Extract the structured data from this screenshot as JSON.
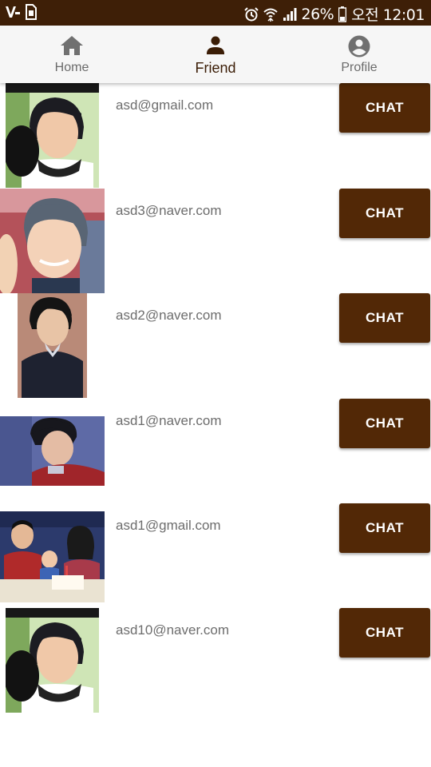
{
  "status_bar": {
    "battery": "26%",
    "time": "오전 12:01",
    "icons": [
      "app-v-icon",
      "sim-icon",
      "alarm-icon",
      "wifi-icon",
      "signal-icon",
      "battery-icon"
    ]
  },
  "nav": {
    "items": [
      {
        "label": "Home",
        "icon": "home-icon",
        "active": false
      },
      {
        "label": "Friend",
        "icon": "person-icon",
        "active": true
      },
      {
        "label": "Profile",
        "icon": "account-circle-icon",
        "active": false
      }
    ]
  },
  "friends": [
    {
      "email": "asd@gmail.com",
      "button": "CHAT"
    },
    {
      "email": "asd3@naver.com",
      "button": "CHAT"
    },
    {
      "email": "asd2@naver.com",
      "button": "CHAT"
    },
    {
      "email": "asd1@naver.com",
      "button": "CHAT"
    },
    {
      "email": "asd1@gmail.com",
      "button": "CHAT"
    },
    {
      "email": "asd10@naver.com",
      "button": "CHAT"
    }
  ],
  "colors": {
    "status_bar": "#3e1f07",
    "accent": "#522806",
    "nav_active": "#3b1d06",
    "nav_inactive": "#6b6b6b"
  }
}
